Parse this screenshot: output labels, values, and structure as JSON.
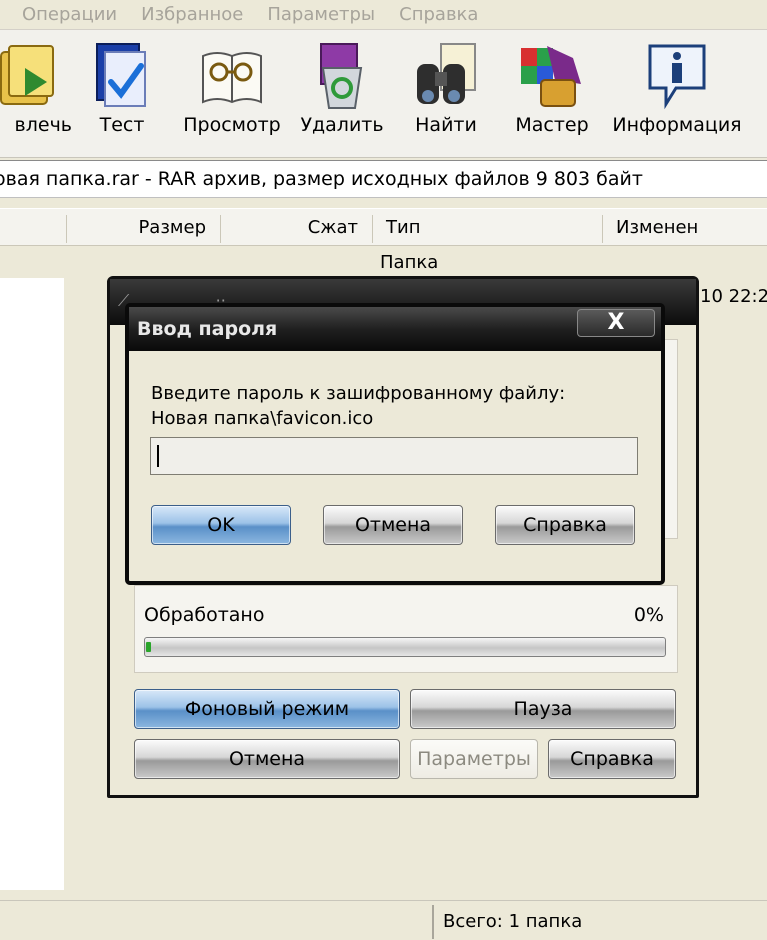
{
  "menu": [
    "Операции",
    "Избранное",
    "Параметры",
    "Справка"
  ],
  "toolbar": {
    "buttons": [
      {
        "label": "влечь",
        "icon": "extract-icon"
      },
      {
        "label": "Тест",
        "icon": "test-icon"
      },
      {
        "label": "Просмотр",
        "icon": "view-icon"
      },
      {
        "label": "Удалить",
        "icon": "delete-icon"
      },
      {
        "label": "Найти",
        "icon": "find-icon"
      },
      {
        "label": "Мастер",
        "icon": "wizard-icon"
      },
      {
        "label": "Информация",
        "icon": "info-icon"
      }
    ]
  },
  "address": "овая папка.rar - RAR архив, размер исходных файлов 9 803 байт",
  "columns": [
    "Размер",
    "Сжат",
    "Тип",
    "Изменен"
  ],
  "filelist": {
    "row_type": "Папка",
    "row_date": "10 22:2"
  },
  "status": {
    "total": "Всего: 1 папка"
  },
  "progress_dialog": {
    "processed_label": "Обработано",
    "processed_value": "0%",
    "progress_fraction": 0.01,
    "buttons": {
      "background": "Фоновый режим",
      "pause": "Пауза",
      "cancel": "Отмена",
      "options": "Параметры",
      "help": "Справка"
    }
  },
  "password_dialog": {
    "title": "Ввод пароля",
    "close": "X",
    "prompt": "Введите пароль к зашифрованному файлу:",
    "file": "Новая папка\\favicon.ico",
    "password_value": "",
    "ok": "OK",
    "cancel": "Отмена",
    "help": "Справка"
  },
  "colors": {
    "accent_blue": "#5a90c8",
    "progress_green": "#2aa52a",
    "titlebar": "#0c0c0c"
  }
}
